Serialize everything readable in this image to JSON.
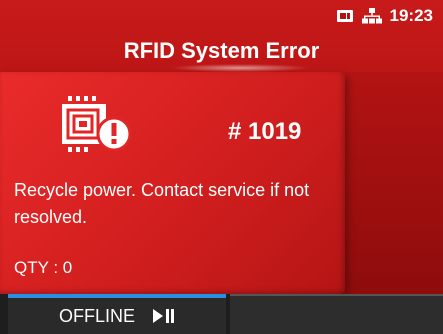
{
  "status_bar": {
    "sd_icon": "sd-card-icon",
    "network_icon": "network-icon",
    "time": "19:23"
  },
  "title": "RFID System Error",
  "error": {
    "icon": "rfid-error-icon",
    "code": "# 1019",
    "message": "Recycle power. Contact service if not resolved.",
    "qty_label": "QTY : 0"
  },
  "bottom_bar": {
    "mode_label": "OFFLINE",
    "play_pause_icon": "play-pause-icon"
  },
  "colors": {
    "background_red": "#b01111",
    "card_red": "#e02626",
    "accent_blue": "#2a8fe0",
    "bottom_bar": "#1e1e1e"
  }
}
